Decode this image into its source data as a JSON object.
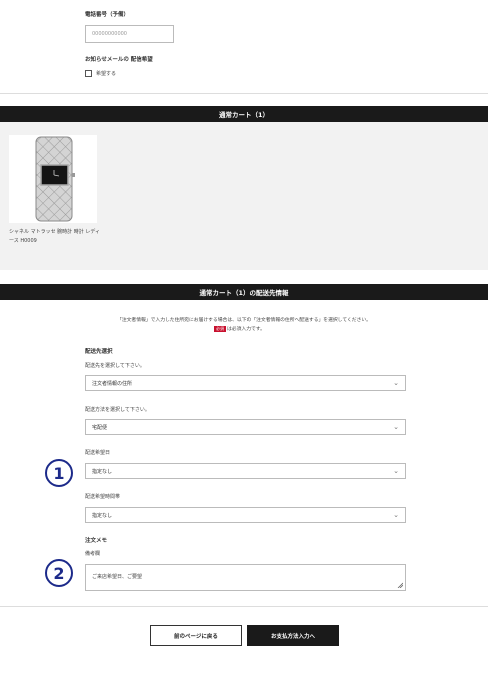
{
  "phone": {
    "label": "電話番号（予備）",
    "placeholder": "00000000000"
  },
  "newsletter": {
    "label": "お知らせメールの 配信希望",
    "checkbox_label": "希望する"
  },
  "cart": {
    "header": "通常カート（1）",
    "product_name": "シャネル マトラッセ 腕時計 時計 レディース H0009"
  },
  "delivery": {
    "header": "通常カート（1）の配送先情報",
    "notice": "「注文者情報」で入力した住所宛にお届けする場合は、以下の「注文者情報の住所へ配送する」を選択してください。",
    "required_badge": "必須",
    "required_note": "は必須入力です。",
    "section_label": "配送先選択",
    "destination_label": "配送先を選択して下さい。",
    "destination_value": "注文者情報の住所",
    "method_label": "配送方法を選択して下さい。",
    "method_value": "宅配便",
    "date_label": "配送希望日",
    "date_value": "指定なし",
    "time_label": "配送希望時間帯",
    "time_value": "指定なし"
  },
  "memo": {
    "label": "注文メモ",
    "sub_label": "備考欄",
    "value": "ご来店希望日、ご要望"
  },
  "markers": [
    "1",
    "2"
  ],
  "buttons": {
    "back": "前のページに戻る",
    "next": "お支払方法入力へ"
  },
  "colors": {
    "header_bg": "#1a1a1a",
    "badge": "#c8102e",
    "marker": "#1c2a8a",
    "product_bg": "#f2f2f2"
  }
}
